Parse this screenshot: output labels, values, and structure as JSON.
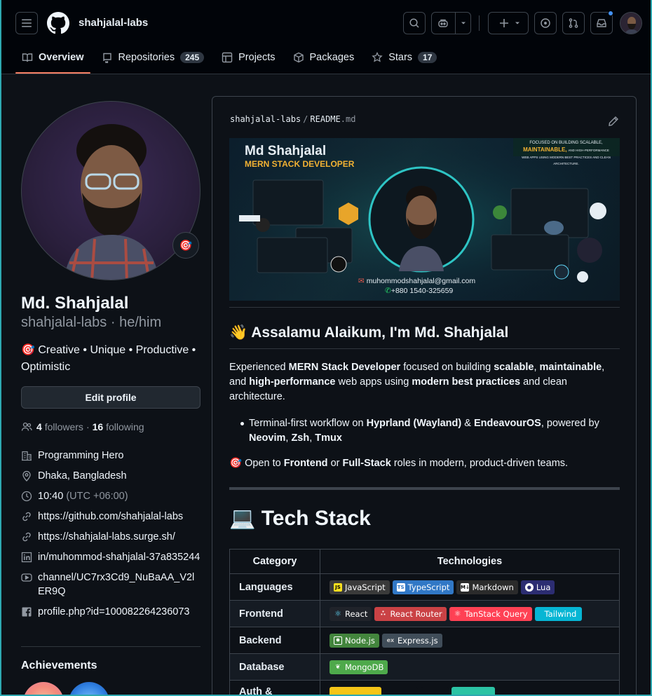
{
  "header": {
    "owner": "shahjalal-labs",
    "tabs": [
      {
        "label": "Overview"
      },
      {
        "label": "Repositories",
        "count": "245"
      },
      {
        "label": "Projects"
      },
      {
        "label": "Packages"
      },
      {
        "label": "Stars",
        "count": "17"
      }
    ]
  },
  "profile": {
    "name": "Md. Shahjalal",
    "login_pronouns": "shahjalal-labs · he/him",
    "bio": "🎯 Creative • Unique • Productive • Optimistic",
    "status_emoji": "🎯",
    "edit_label": "Edit profile",
    "followers": "4",
    "followers_label": "followers",
    "dot": "·",
    "following": "16",
    "following_label": "following",
    "company": "Programming Hero",
    "location": "Dhaka, Bangladesh",
    "time": "10:40",
    "timezone": "(UTC +06:00)",
    "website1": "https://github.com/shahjalal-labs",
    "website2": "https://shahjalal-labs.surge.sh/",
    "linkedin": "in/muhommod-shahjalal-37a835244",
    "youtube": "channel/UC7rx3Cd9_NuBaAA_V2lER9Q",
    "facebook": "profile.php?id=100082264236073",
    "achievements_title": "Achievements"
  },
  "readme": {
    "breadcrumb_owner": "shahjalal-labs",
    "breadcrumb_sep": "/",
    "breadcrumb_file": "README",
    "breadcrumb_ext": ".md",
    "banner": {
      "name": "Md Shahjalal",
      "role": "MERN STACK DEVELOPER",
      "focus_line1": "FOCUSED ON BUILDING SCALABLE,",
      "focus_line2": "MAINTAINABLE,",
      "focus_line2b": "AND HIGH-PERFORMANCE",
      "focus_line3": "WEB APPS USING MODERN BEST PRACTICES AND CLEAN ARCHITECTURE.",
      "email": "muhommodshahjalal@gmail.com",
      "phone": "+880 1540-325659"
    },
    "greeting": "👋 Assalamu Alaikum, I'm Md. Shahjalal",
    "intro_1": "Experienced ",
    "intro_b1": "MERN Stack Developer",
    "intro_2": " focused on building ",
    "intro_b2": "scalable",
    "intro_3": ", ",
    "intro_b3": "maintainable",
    "intro_4": ", and ",
    "intro_b4": "high-performance",
    "intro_5": " web apps using ",
    "intro_b5": "modern best practices",
    "intro_6": " and clean architecture.",
    "bullet_1": "Terminal-first workflow on ",
    "bullet_b1": "Hyprland (Wayland)",
    "bullet_2": " & ",
    "bullet_b2": "EndeavourOS",
    "bullet_3": ", powered by ",
    "bullet_b3": "Neovim",
    "bullet_4": ", ",
    "bullet_b4": "Zsh",
    "bullet_5": ", ",
    "bullet_b5": "Tmux",
    "open_1": "🎯 Open to ",
    "open_b1": "Frontend",
    "open_2": " or ",
    "open_b2": "Full-Stack",
    "open_3": " roles in modern, product-driven teams.",
    "tech_title": "💻 Tech Stack",
    "table_headers": [
      "Category",
      "Technologies"
    ],
    "rows": [
      {
        "category": "Languages",
        "badges": [
          "JavaScript",
          "TypeScript",
          "Markdown",
          "Lua"
        ]
      },
      {
        "category": "Frontend",
        "badges": [
          "React",
          "React Router",
          "TanStack Query",
          "Tailwind"
        ]
      },
      {
        "category": "Backend",
        "badges": [
          "Node.js",
          "Express.js"
        ]
      },
      {
        "category": "Database",
        "badges": [
          "MongoDB"
        ]
      },
      {
        "category": "Auth &",
        "badges": []
      }
    ]
  },
  "colors": {
    "accent_underline": "#f78166",
    "link_blue": "#4493f8",
    "badge_js": "#3a3a3a",
    "badge_ts": "#3178c6",
    "badge_md": "#2b2b2b",
    "badge_lua": "#2c2d72",
    "badge_react": "#20232a",
    "badge_router": "#ca4245",
    "badge_tanstack": "#ff4154",
    "badge_tailwind": "#06b6d4",
    "badge_node": "#43853d",
    "badge_express": "#404d59",
    "badge_mongo": "#4ea94b"
  }
}
